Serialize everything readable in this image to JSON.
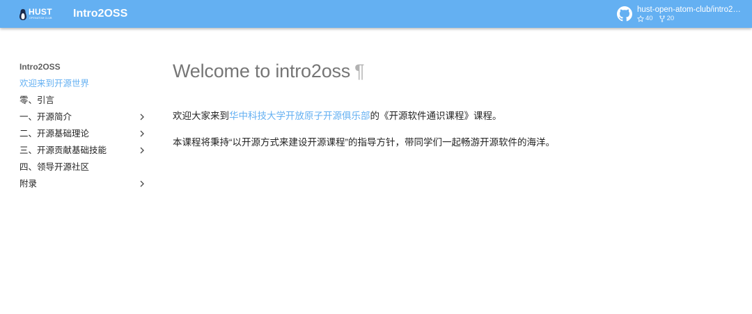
{
  "header": {
    "logo_text": "HUST",
    "logo_subtext": "OPENATOM CLUB",
    "site_title": "Intro2OSS",
    "repo_name": "hust-open-atom-club/intro2…",
    "stars": "40",
    "forks": "20"
  },
  "sidebar": {
    "title": "Intro2OSS",
    "items": [
      {
        "label": "欢迎来到开源世界",
        "active": true,
        "expandable": false
      },
      {
        "label": "零、引言",
        "active": false,
        "expandable": false
      },
      {
        "label": "一、开源简介",
        "active": false,
        "expandable": true
      },
      {
        "label": "二、开源基础理论",
        "active": false,
        "expandable": true
      },
      {
        "label": "三、开源贡献基础技能",
        "active": false,
        "expandable": true
      },
      {
        "label": "四、领导开源社区",
        "active": false,
        "expandable": false
      },
      {
        "label": "附录",
        "active": false,
        "expandable": true
      }
    ]
  },
  "main": {
    "heading": "Welcome to intro2oss",
    "permalink_symbol": "¶",
    "p1_before": "欢迎大家来到",
    "p1_link": "华中科技大学开放原子开源俱乐部",
    "p1_after": "的《开源软件通识课程》课程。",
    "p2": "本课程将秉持“以开源方式来建设开源课程”的指导方针，带同学们一起畅游开源软件的海洋。"
  },
  "colors": {
    "primary": "#64b0f2",
    "text": "#000000de",
    "heading": "#0000008a"
  },
  "icons": {
    "repo": "github-icon",
    "stars": "star-icon",
    "forks": "fork-icon",
    "expand": "chevron-right-icon"
  }
}
